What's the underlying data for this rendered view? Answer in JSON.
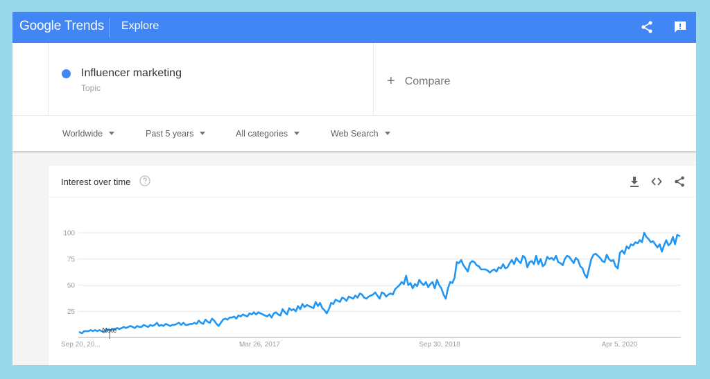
{
  "header": {
    "logo_google": "Google",
    "logo_trends": "Trends",
    "section": "Explore",
    "icons": [
      "share-icon",
      "feedback-icon"
    ],
    "color": "#4285f4"
  },
  "search": {
    "term": "Influencer marketing",
    "term_type": "Topic",
    "term_color": "#4285f4",
    "compare_label": "Compare"
  },
  "filters": [
    {
      "label": "Worldwide"
    },
    {
      "label": "Past 5 years"
    },
    {
      "label": "All categories"
    },
    {
      "label": "Web Search"
    }
  ],
  "card": {
    "title": "Interest over time",
    "icons": [
      "help-icon",
      "download-icon",
      "embed-icon",
      "share-icon"
    ]
  },
  "chart_data": {
    "type": "line",
    "title": "Interest over time",
    "xlabel": "",
    "ylabel": "",
    "ylim": [
      0,
      100
    ],
    "yticks": [
      25,
      50,
      75,
      100
    ],
    "xtick_labels": [
      "Sep 20, 20...",
      "Mar 26, 2017",
      "Sep 30, 2018",
      "Apr 5, 2020"
    ],
    "xtick_positions": [
      0,
      0.3,
      0.6,
      0.9
    ],
    "grid": true,
    "annotation": {
      "label": "Note",
      "at_fraction": 0.05
    },
    "series": [
      {
        "name": "Influencer marketing",
        "color": "#2196f3",
        "values": [
          5,
          4,
          6,
          6,
          6,
          7,
          6,
          7,
          6,
          7,
          6,
          5,
          8,
          7,
          7,
          8,
          8,
          9,
          8,
          9,
          10,
          9,
          10,
          11,
          10,
          9,
          11,
          10,
          10,
          12,
          11,
          10,
          12,
          11,
          12,
          14,
          11,
          12,
          11,
          13,
          12,
          11,
          12,
          12,
          13,
          14,
          12,
          14,
          12,
          12,
          13,
          13,
          14,
          13,
          16,
          14,
          13,
          17,
          15,
          14,
          18,
          16,
          13,
          11,
          14,
          17,
          18,
          17,
          19,
          19,
          20,
          18,
          21,
          20,
          22,
          21,
          20,
          23,
          22,
          24,
          22,
          24,
          23,
          22,
          21,
          20,
          22,
          19,
          23,
          24,
          22,
          21,
          27,
          24,
          22,
          28,
          26,
          27,
          25,
          30,
          27,
          32,
          29,
          31,
          30,
          29,
          28,
          34,
          30,
          33,
          28,
          26,
          23,
          27,
          33,
          32,
          36,
          35,
          34,
          38,
          37,
          35,
          39,
          38,
          37,
          40,
          38,
          42,
          41,
          38,
          37,
          39,
          40,
          41,
          43,
          40,
          37,
          43,
          42,
          39,
          41,
          42,
          41,
          46,
          48,
          50,
          53,
          51,
          59,
          50,
          52,
          47,
          51,
          49,
          55,
          52,
          50,
          53,
          48,
          51,
          53,
          47,
          55,
          50,
          47,
          41,
          37,
          47,
          53,
          52,
          57,
          72,
          71,
          74,
          69,
          66,
          63,
          71,
          73,
          72,
          69,
          68,
          65,
          65,
          65,
          64,
          62,
          64,
          65,
          63,
          67,
          66,
          70,
          66,
          67,
          71,
          74,
          70,
          76,
          73,
          71,
          78,
          76,
          67,
          72,
          73,
          70,
          78,
          70,
          75,
          68,
          70,
          77,
          75,
          76,
          74,
          78,
          72,
          71,
          69,
          75,
          78,
          77,
          74,
          71,
          76,
          74,
          68,
          66,
          60,
          57,
          66,
          75,
          79,
          80,
          78,
          76,
          73,
          72,
          79,
          75,
          73,
          74,
          68,
          66,
          81,
          83,
          80,
          87,
          85,
          89,
          88,
          91,
          90,
          93,
          91,
          100,
          96,
          94,
          91,
          92,
          89,
          86,
          89,
          82,
          88,
          93,
          88,
          90,
          96,
          89,
          98,
          97
        ]
      }
    ]
  }
}
